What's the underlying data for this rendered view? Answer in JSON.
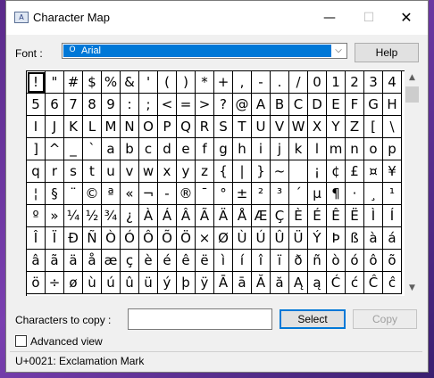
{
  "window": {
    "title": "Character Map",
    "minimize_glyph": "—",
    "maximize_glyph": "☐",
    "close_glyph": "✕",
    "icon_glyph": "A"
  },
  "font": {
    "label": "Font :",
    "selected": "Arial",
    "icon_glyph": "O",
    "dropdown_glyph": "⌵"
  },
  "help_label": "Help",
  "grid": {
    "selected_index": 0,
    "rows": [
      [
        "!",
        "\"",
        "#",
        "$",
        "%",
        "&",
        "'",
        "(",
        ")",
        "*",
        "+",
        ",",
        "-",
        ".",
        "/",
        "0",
        "1",
        "2",
        "3",
        "4"
      ],
      [
        "5",
        "6",
        "7",
        "8",
        "9",
        ":",
        ";",
        "<",
        "=",
        ">",
        "?",
        "@",
        "A",
        "B",
        "C",
        "D",
        "E",
        "F",
        "G",
        "H"
      ],
      [
        "I",
        "J",
        "K",
        "L",
        "M",
        "N",
        "O",
        "P",
        "Q",
        "R",
        "S",
        "T",
        "U",
        "V",
        "W",
        "X",
        "Y",
        "Z",
        "[",
        "\\"
      ],
      [
        "]",
        "^",
        "_",
        "`",
        "a",
        "b",
        "c",
        "d",
        "e",
        "f",
        "g",
        "h",
        "i",
        "j",
        "k",
        "l",
        "m",
        "n",
        "o",
        "p"
      ],
      [
        "q",
        "r",
        "s",
        "t",
        "u",
        "v",
        "w",
        "x",
        "y",
        "z",
        "{",
        "|",
        "}",
        "~",
        " ",
        "¡",
        "¢",
        "£",
        "¤",
        "¥"
      ],
      [
        "¦",
        "§",
        "¨",
        "©",
        "ª",
        "«",
        "¬",
        "-",
        "®",
        "¯",
        "°",
        "±",
        "²",
        "³",
        "´",
        "µ",
        "¶",
        "·",
        "¸",
        "¹"
      ],
      [
        "º",
        "»",
        "¼",
        "½",
        "¾",
        "¿",
        "À",
        "Á",
        "Â",
        "Ã",
        "Ä",
        "Å",
        "Æ",
        "Ç",
        "È",
        "É",
        "Ê",
        "Ë",
        "Ì",
        "Í"
      ],
      [
        "Î",
        "Ï",
        "Ð",
        "Ñ",
        "Ò",
        "Ó",
        "Ô",
        "Õ",
        "Ö",
        "×",
        "Ø",
        "Ù",
        "Ú",
        "Û",
        "Ü",
        "Ý",
        "Þ",
        "ß",
        "à",
        "á"
      ],
      [
        "â",
        "ã",
        "ä",
        "å",
        "æ",
        "ç",
        "è",
        "é",
        "ê",
        "ë",
        "ì",
        "í",
        "î",
        "ï",
        "ð",
        "ñ",
        "ò",
        "ó",
        "ô",
        "õ"
      ],
      [
        "ö",
        "÷",
        "ø",
        "ù",
        "ú",
        "û",
        "ü",
        "ý",
        "þ",
        "ÿ",
        "Ā",
        "ā",
        "Ă",
        "ă",
        "Ą",
        "ą",
        "Ć",
        "ć",
        "Ĉ",
        "ĉ"
      ]
    ]
  },
  "scrollbar": {
    "up_glyph": "▲",
    "down_glyph": "▼",
    "position": 0
  },
  "copy": {
    "label": "Characters to copy :",
    "value": "",
    "select_label": "Select",
    "copy_label": "Copy"
  },
  "advanced_view": {
    "label": "Advanced view",
    "checked": false
  },
  "status": {
    "text": "U+0021: Exclamation Mark"
  },
  "colors": {
    "selection": "#0078d7",
    "window_bg": "#f0f0f0",
    "desktop": "#6a33a0"
  }
}
